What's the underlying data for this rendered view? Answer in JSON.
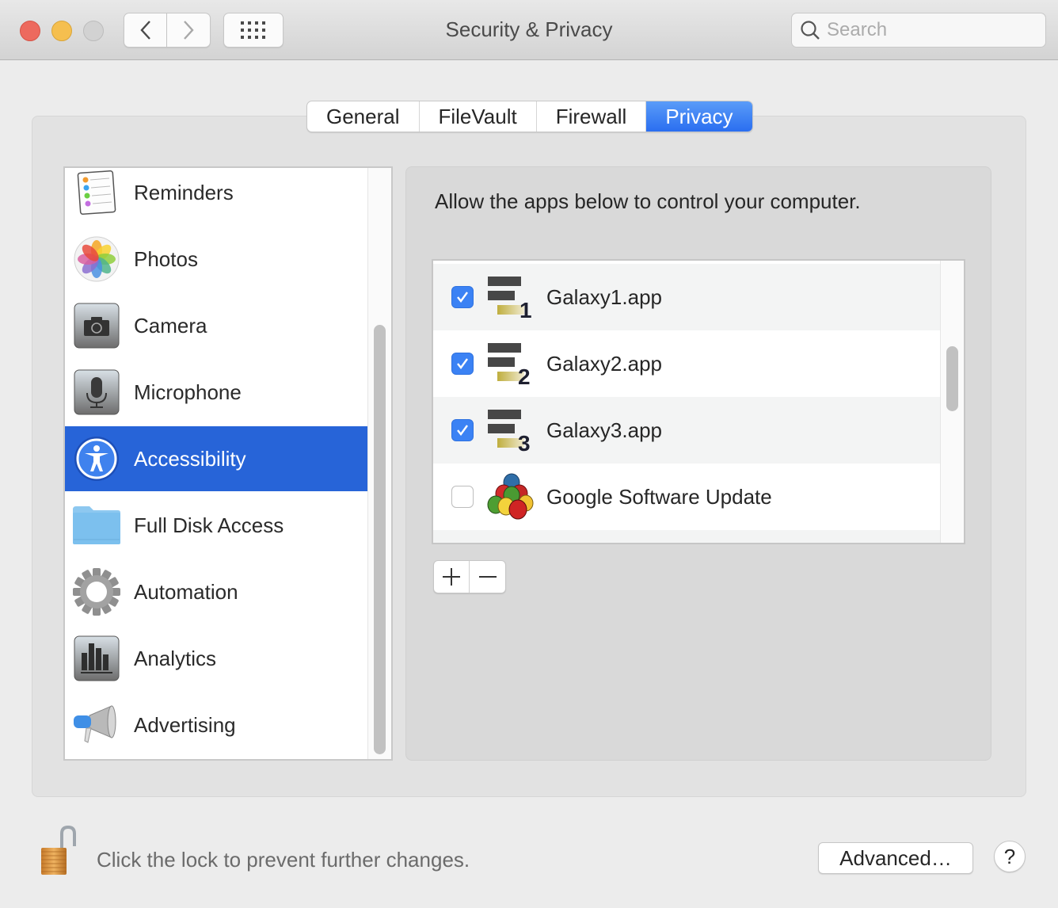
{
  "window": {
    "title": "Security & Privacy",
    "search_placeholder": "Search"
  },
  "tabs": [
    {
      "label": "General",
      "active": false
    },
    {
      "label": "FileVault",
      "active": false
    },
    {
      "label": "Firewall",
      "active": false
    },
    {
      "label": "Privacy",
      "active": true
    }
  ],
  "sidebar": {
    "items": [
      {
        "label": "Reminders",
        "icon": "reminders-icon"
      },
      {
        "label": "Photos",
        "icon": "photos-icon"
      },
      {
        "label": "Camera",
        "icon": "camera-icon"
      },
      {
        "label": "Microphone",
        "icon": "microphone-icon"
      },
      {
        "label": "Accessibility",
        "icon": "accessibility-icon",
        "selected": true
      },
      {
        "label": "Full Disk Access",
        "icon": "folder-icon"
      },
      {
        "label": "Automation",
        "icon": "gear-icon"
      },
      {
        "label": "Analytics",
        "icon": "analytics-icon"
      },
      {
        "label": "Advertising",
        "icon": "megaphone-icon"
      }
    ]
  },
  "main": {
    "description": "Allow the apps below to control your computer.",
    "apps": [
      {
        "name": "Galaxy1.app",
        "checked": true,
        "badge": "1"
      },
      {
        "name": "Galaxy2.app",
        "checked": true,
        "badge": "2"
      },
      {
        "name": "Galaxy3.app",
        "checked": true,
        "badge": "3"
      },
      {
        "name": "Google Software Update",
        "checked": false
      }
    ],
    "add_label": "+",
    "remove_label": "−"
  },
  "footer": {
    "lock_text": "Click the lock to prevent further changes.",
    "advanced_label": "Advanced…",
    "help_label": "?"
  },
  "colors": {
    "accent": "#2764d8",
    "tab_active": "#3a7df3",
    "checkbox_on": "#3b82f4"
  }
}
